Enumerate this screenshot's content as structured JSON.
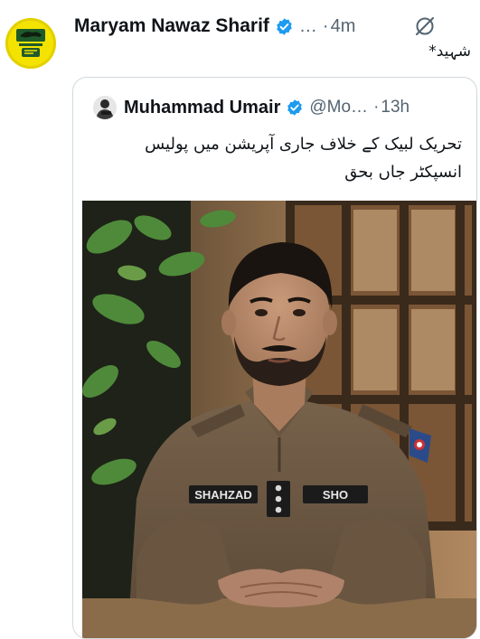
{
  "post": {
    "author_name": "Maryam Nawaz Sharif",
    "handle": "…",
    "separator": "·",
    "time": "4m",
    "text": "شہید*"
  },
  "quoted_post": {
    "author_name": "Muhammad Umair",
    "handle": "@Mo…",
    "separator": "·",
    "time": "13h",
    "text_line1": "تحریک لبیک کے خلاف جاری آپریشن میں پولیس",
    "text_line2": "انسپکٹر جاں بحق"
  },
  "photo": {
    "name_tag": "SHAHZAD",
    "rank_tag": "SHO"
  },
  "colors": {
    "verified": "#1d9bf0",
    "avatar_bg": "#f4e200",
    "muted_text": "#536471",
    "border": "#cfd9de",
    "uniform": "#6e5a45"
  },
  "icons": {
    "verified": "verified-badge-icon",
    "mute": "mute-icon",
    "party_logo": "tiger-logo-icon"
  }
}
